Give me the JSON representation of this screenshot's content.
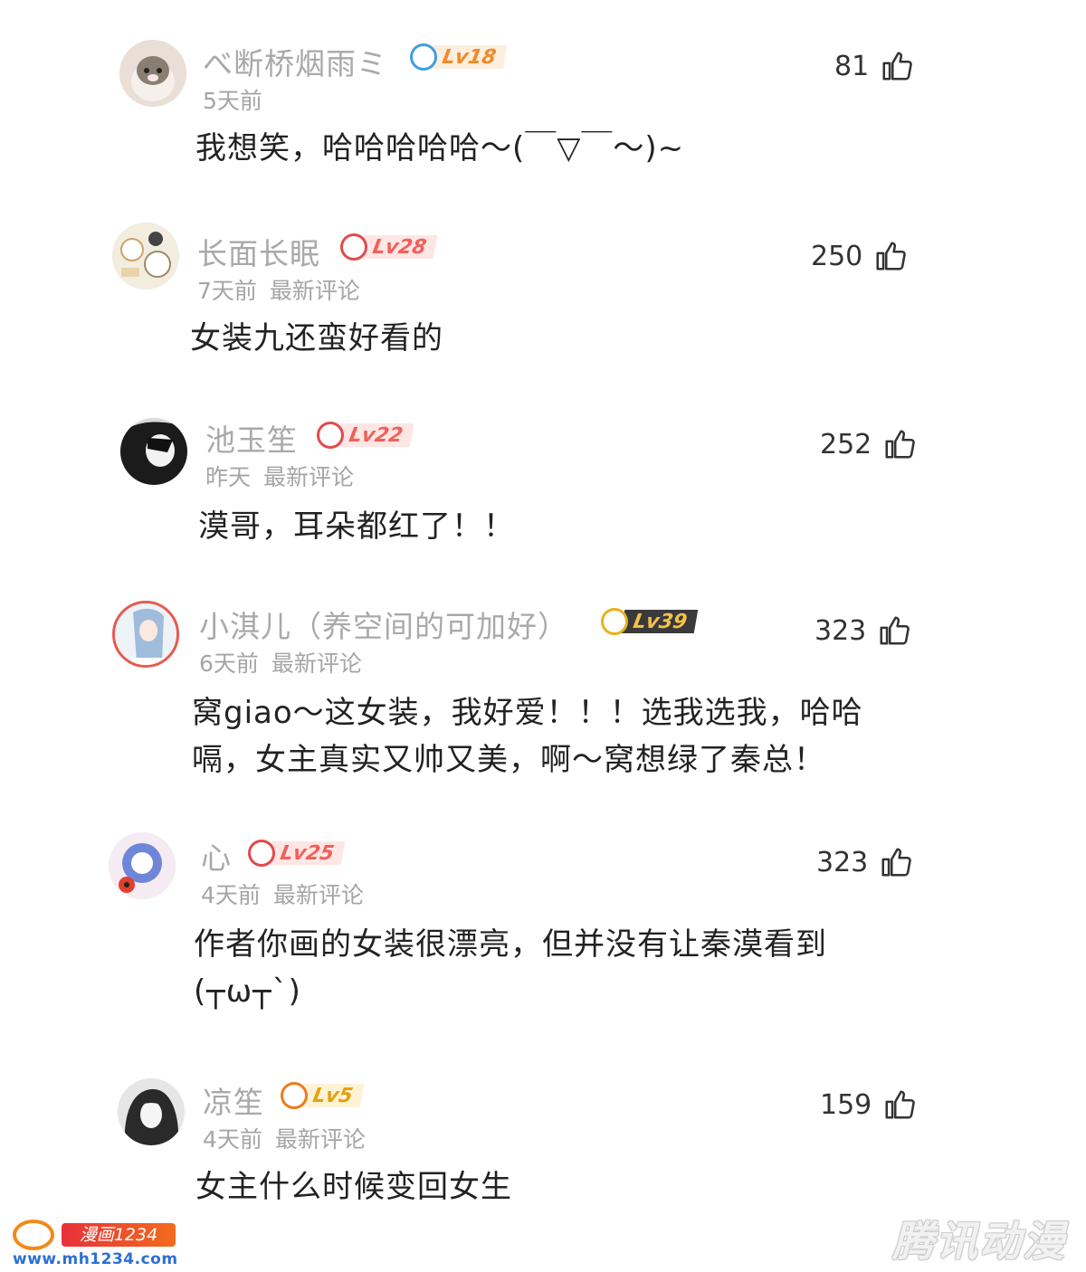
{
  "comments": [
    {
      "username": "べ断桥烟雨ミ",
      "level": "Lv18",
      "time": "5天前",
      "tag": "",
      "likes": "81",
      "lines": [
        "我想笑，哈哈哈哈哈～(￣▽￣～)~"
      ]
    },
    {
      "username": "长面长眠",
      "level": "Lv28",
      "time": "7天前",
      "tag": "最新评论",
      "likes": "250",
      "lines": [
        "女装九还蛮好看的"
      ]
    },
    {
      "username": "池玉笙",
      "level": "Lv22",
      "time": "昨天",
      "tag": "最新评论",
      "likes": "252",
      "lines": [
        "漠哥，耳朵都红了！！"
      ]
    },
    {
      "username": "小淇儿（养空间的可加好）",
      "level": "Lv39",
      "time": "6天前",
      "tag": "最新评论",
      "likes": "323",
      "lines": [
        "窝giao～这女装，我好爱！！！选我选我，哈哈",
        "嗝，女主真实又帅又美，啊～窝想绿了秦总！"
      ]
    },
    {
      "username": "心",
      "level": "Lv25",
      "time": "4天前",
      "tag": "最新评论",
      "likes": "323",
      "lines": [
        "作者你画的女装很漂亮，但并没有让秦漠看到",
        "(┬ω┬`)"
      ]
    },
    {
      "username": "凉笙",
      "level": "Lv5",
      "time": "4天前",
      "tag": "最新评论",
      "likes": "159",
      "lines": [
        "女主什么时候变回女生"
      ]
    }
  ],
  "watermarks": {
    "left_tag": "漫画1234",
    "left_url": "www.mh1234.com",
    "right": "腾讯动漫"
  },
  "colors": {
    "username": "#a9a9a9",
    "meta": "#a5a5a5",
    "content": "#222222",
    "badge_red": "#f0605a"
  },
  "icons": {
    "like": "thumb-up-icon"
  }
}
